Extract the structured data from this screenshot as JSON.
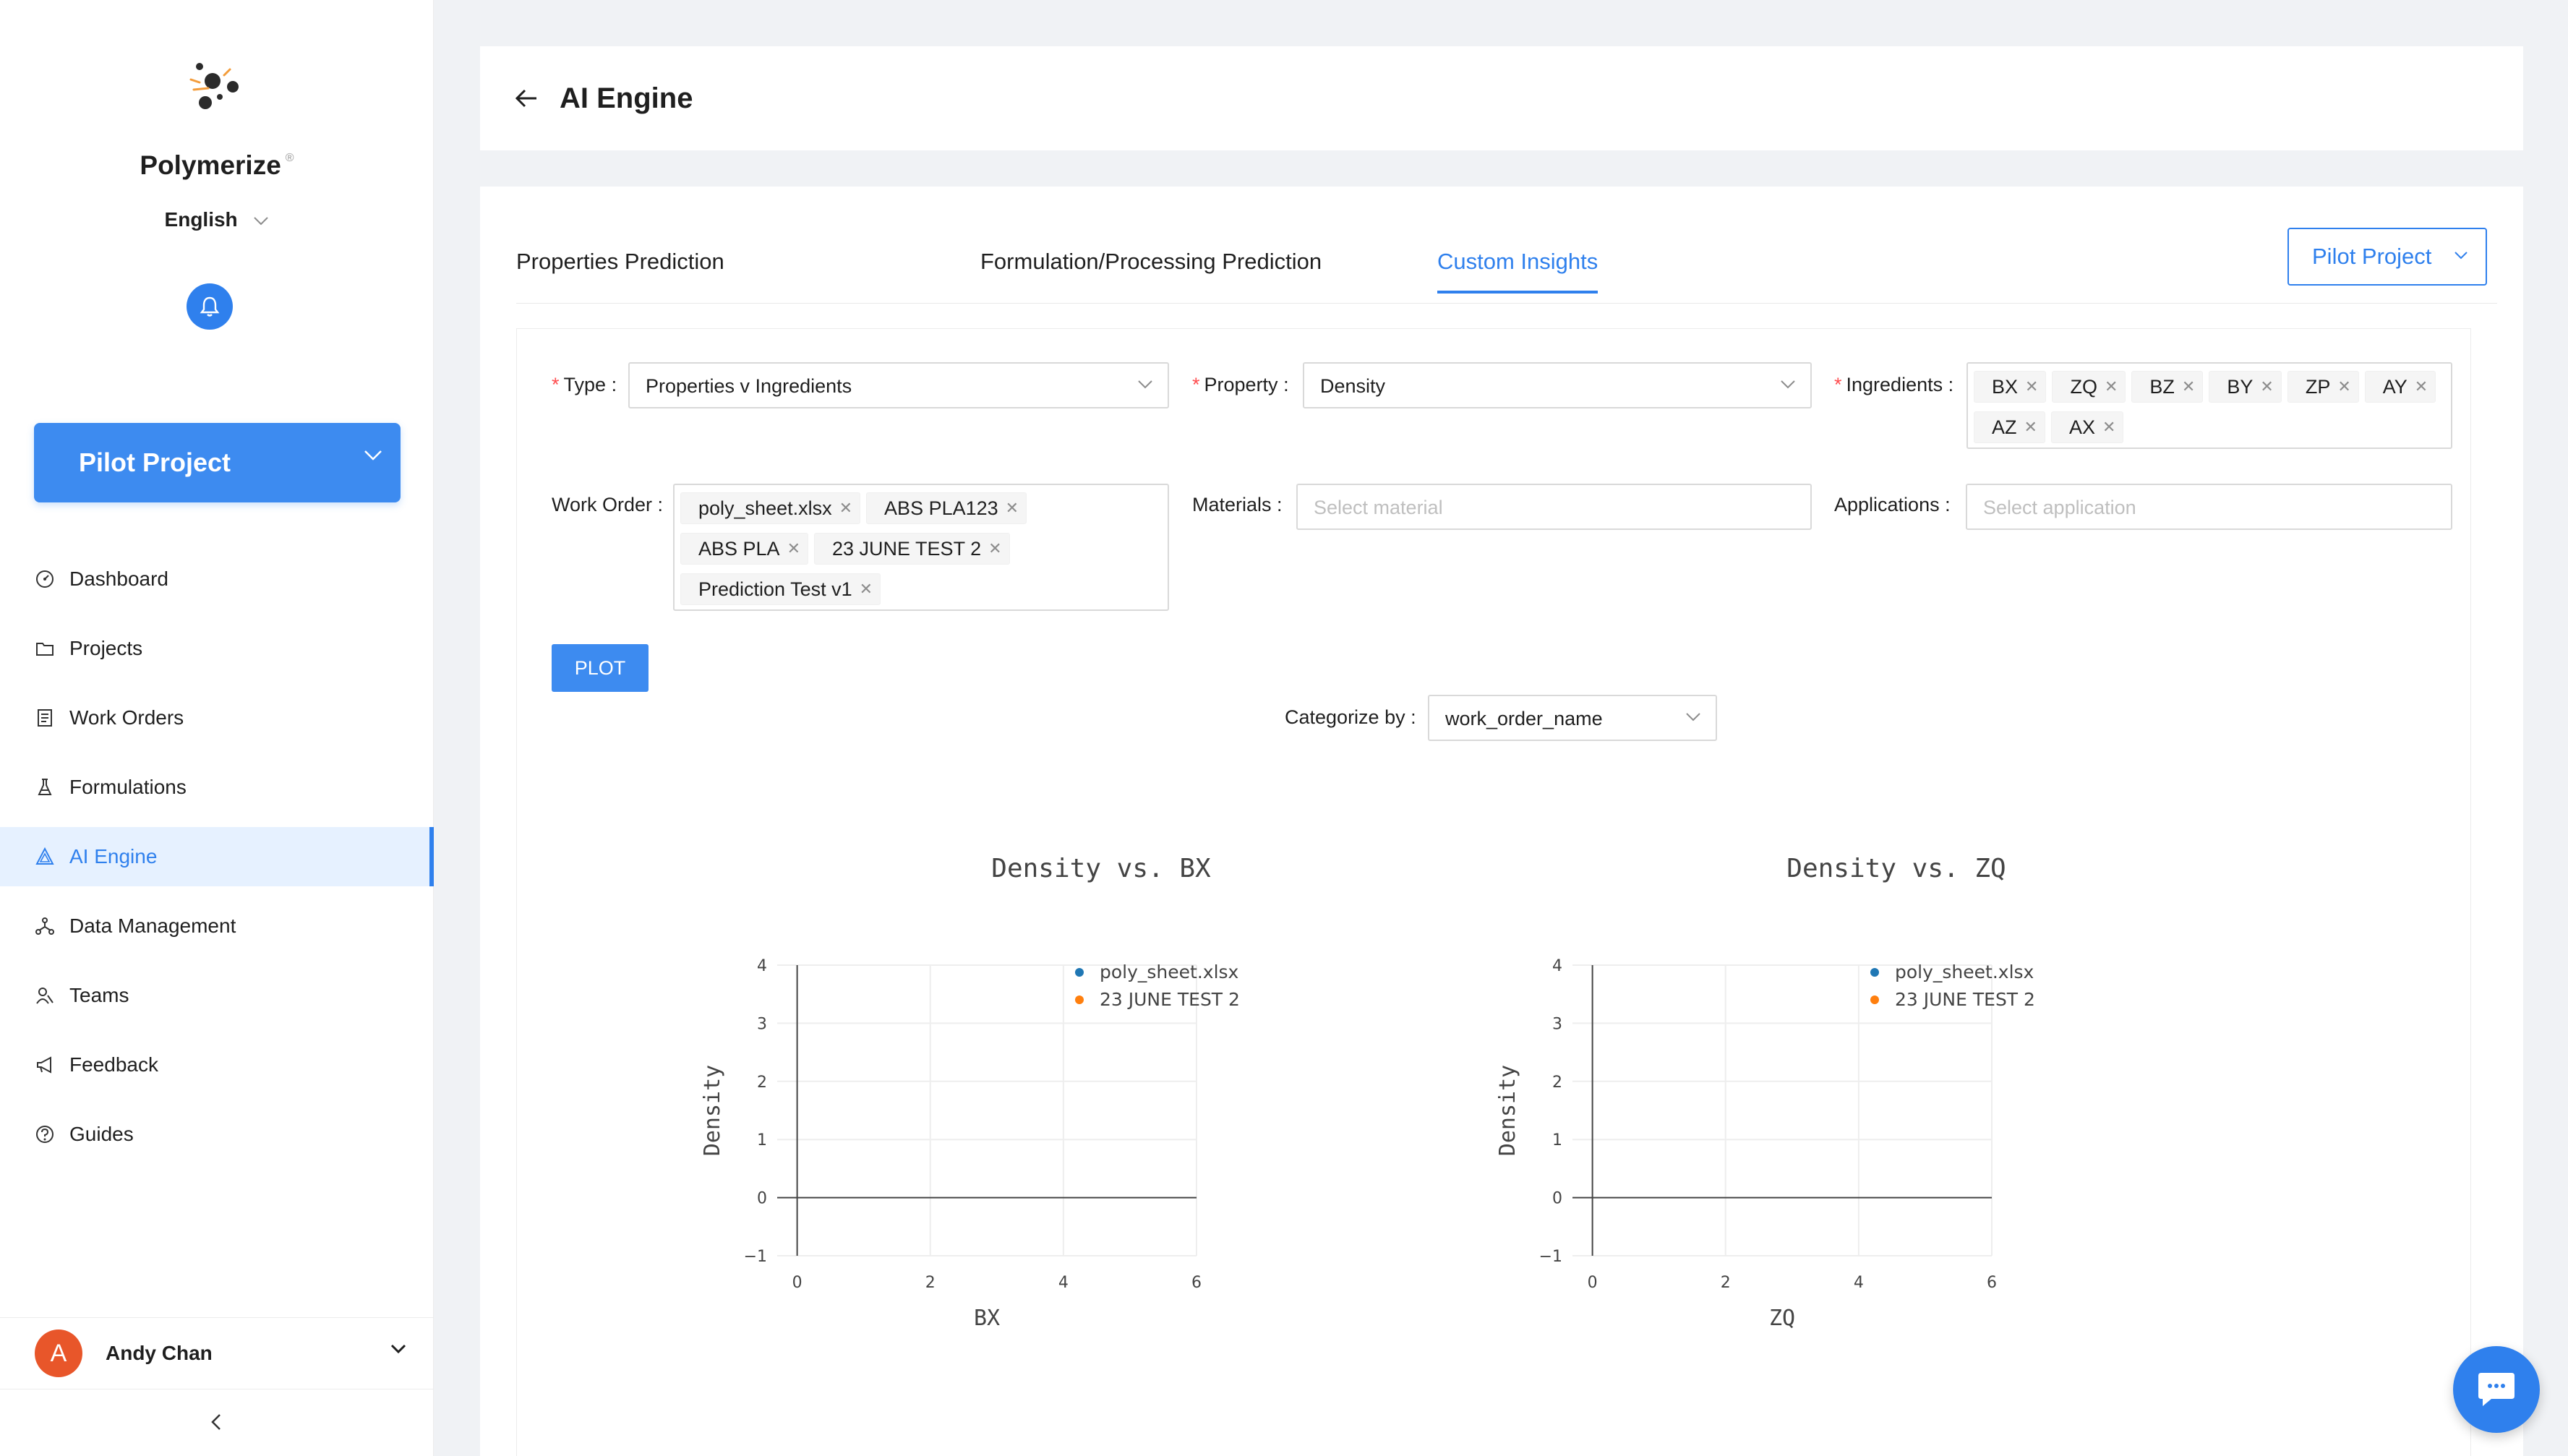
{
  "app": {
    "brand": "Polymerize",
    "brand_mark": "®",
    "language": "English"
  },
  "sidebar": {
    "project_button": "Pilot Project",
    "nav": [
      {
        "label": "Dashboard",
        "icon": "dashboard-icon"
      },
      {
        "label": "Projects",
        "icon": "folder-icon"
      },
      {
        "label": "Work Orders",
        "icon": "file-icon"
      },
      {
        "label": "Formulations",
        "icon": "flask-icon"
      },
      {
        "label": "AI Engine",
        "icon": "ai-engine-icon",
        "active": true
      },
      {
        "label": "Data Management",
        "icon": "network-icon"
      },
      {
        "label": "Teams",
        "icon": "team-icon"
      },
      {
        "label": "Feedback",
        "icon": "megaphone-icon"
      },
      {
        "label": "Guides",
        "icon": "question-icon"
      }
    ],
    "user": {
      "initial": "A",
      "name": "Andy Chan"
    }
  },
  "header": {
    "title": "AI Engine"
  },
  "tabs": [
    {
      "label": "Properties Prediction"
    },
    {
      "label": "Formulation/Processing Prediction"
    },
    {
      "label": "Custom Insights",
      "active": true
    }
  ],
  "project_select": "Pilot Project",
  "form": {
    "type": {
      "label": "Type",
      "value": "Properties v Ingredients"
    },
    "property": {
      "label": "Property",
      "value": "Density"
    },
    "ingredients": {
      "label": "Ingredients",
      "tags": [
        "BX",
        "ZQ",
        "BZ",
        "BY",
        "ZP",
        "AY",
        "AZ",
        "AX"
      ]
    },
    "work_order": {
      "label": "Work Order",
      "tags": [
        "poly_sheet.xlsx",
        "ABS PLA123",
        "ABS PLA",
        "23 JUNE TEST 2",
        "Prediction Test v1"
      ]
    },
    "materials": {
      "label": "Materials",
      "placeholder": "Select material"
    },
    "applications": {
      "label": "Applications",
      "placeholder": "Select application"
    },
    "plot_button": "PLOT",
    "categorize": {
      "label": "Categorize by",
      "value": "work_order_name"
    }
  },
  "colors": {
    "accent": "#2f80ed",
    "series1": "#1f77b4",
    "series2": "#ff7f0e"
  },
  "chart_data": [
    {
      "type": "scatter",
      "title": "Density vs. BX",
      "xlabel": "BX",
      "ylabel": "Density",
      "xlim": [
        -0.3,
        6
      ],
      "ylim": [
        -1,
        4
      ],
      "xticks": [
        "0",
        "2",
        "4",
        "6"
      ],
      "yticks": [
        "−1",
        "0",
        "1",
        "2",
        "3",
        "4"
      ],
      "grid": true,
      "legend_position": "top-right",
      "series": [
        {
          "name": "poly_sheet.xlsx",
          "color": "#1f77b4",
          "points": []
        },
        {
          "name": "23 JUNE TEST 2",
          "color": "#ff7f0e",
          "points": []
        }
      ]
    },
    {
      "type": "scatter",
      "title": "Density vs. ZQ",
      "xlabel": "ZQ",
      "ylabel": "Density",
      "xlim": [
        -0.3,
        6
      ],
      "ylim": [
        -1,
        4
      ],
      "xticks": [
        "0",
        "2",
        "4",
        "6"
      ],
      "yticks": [
        "−1",
        "0",
        "1",
        "2",
        "3",
        "4"
      ],
      "grid": true,
      "legend_position": "top-right",
      "series": [
        {
          "name": "poly_sheet.xlsx",
          "color": "#1f77b4",
          "points": []
        },
        {
          "name": "23 JUNE TEST 2",
          "color": "#ff7f0e",
          "points": []
        }
      ]
    }
  ]
}
